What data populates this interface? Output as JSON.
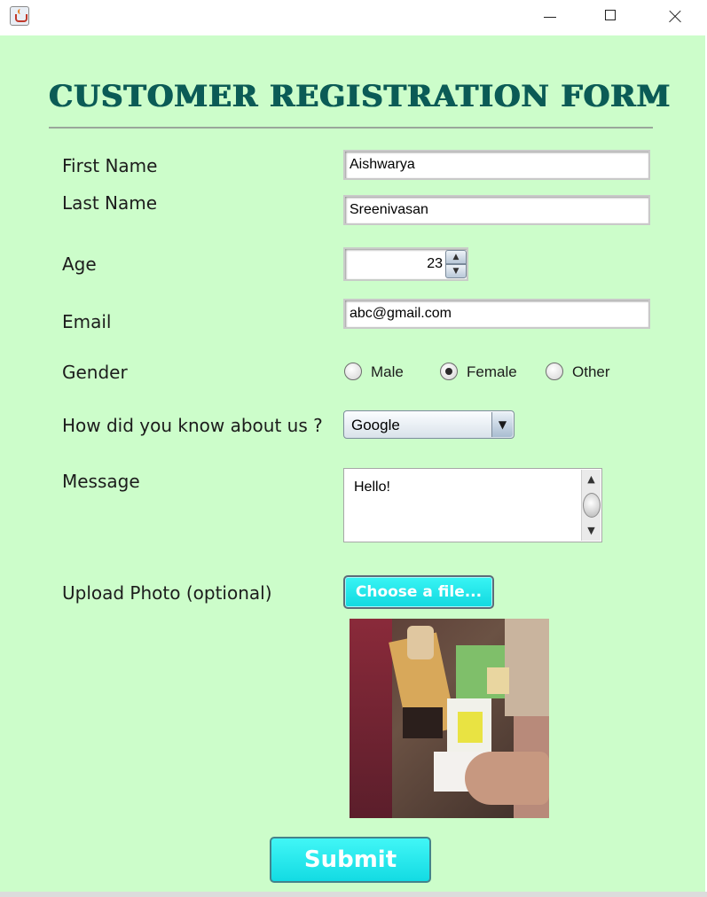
{
  "window": {
    "app_icon": "java-cup-icon",
    "controls": [
      "minimize",
      "maximize",
      "close"
    ]
  },
  "form": {
    "title": "CUSTOMER REGISTRATION FORM",
    "first_name": {
      "label": "First Name",
      "value": "Aishwarya"
    },
    "last_name": {
      "label": "Last Name",
      "value": "Sreenivasan"
    },
    "age": {
      "label": "Age",
      "value": "23"
    },
    "email": {
      "label": "Email",
      "value": "abc@gmail.com"
    },
    "gender": {
      "label": "Gender",
      "options": [
        {
          "label": "Male",
          "selected": false
        },
        {
          "label": "Female",
          "selected": true
        },
        {
          "label": "Other",
          "selected": false
        }
      ]
    },
    "referral": {
      "label": "How did you know about us ?",
      "value": "Google"
    },
    "message": {
      "label": "Message",
      "value": "Hello!"
    },
    "upload": {
      "label": "Upload Photo (optional)",
      "button": "Choose a file..."
    },
    "submit_label": "Submit"
  },
  "colors": {
    "background": "#ccfdca",
    "title": "#0b5b56",
    "button": "#1ee6ec"
  }
}
